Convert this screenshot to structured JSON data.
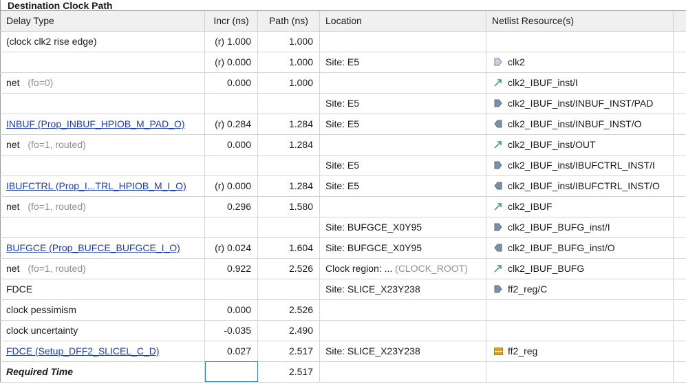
{
  "section_title": "Destination Clock Path",
  "columns": [
    "Delay Type",
    "Incr (ns)",
    "Path (ns)",
    "Location",
    "Netlist Resource(s)"
  ],
  "rows": [
    {
      "type": "(clock clk2 rise edge)",
      "type_dim": "",
      "link": false,
      "bold": false,
      "incr": "(r) 1.000",
      "path": "1.000",
      "location": "",
      "location_dim": "",
      "icon": "",
      "resource": ""
    },
    {
      "type": "",
      "type_dim": "",
      "link": false,
      "bold": false,
      "incr": "(r) 0.000",
      "path": "1.000",
      "location": "Site: E5",
      "location_dim": "",
      "icon": "port-icon",
      "resource": "clk2"
    },
    {
      "type": "net",
      "type_dim": " (fo=0)",
      "link": false,
      "bold": false,
      "incr": "0.000",
      "path": "1.000",
      "location": "",
      "location_dim": "",
      "icon": "net-icon",
      "resource": "clk2_IBUF_inst/I"
    },
    {
      "type": "",
      "type_dim": "",
      "link": false,
      "bold": false,
      "incr": "",
      "path": "",
      "location": "Site: E5",
      "location_dim": "",
      "icon": "input-pin-icon",
      "resource": "clk2_IBUF_inst/INBUF_INST/PAD"
    },
    {
      "type": "INBUF (Prop_INBUF_HPIOB_M_PAD_O)",
      "type_dim": "",
      "link": true,
      "bold": false,
      "incr": "(r) 0.284",
      "path": "1.284",
      "location": "Site: E5",
      "location_dim": "",
      "icon": "output-pin-icon",
      "resource": "clk2_IBUF_inst/INBUF_INST/O"
    },
    {
      "type": "net",
      "type_dim": " (fo=1, routed)",
      "link": false,
      "bold": false,
      "incr": "0.000",
      "path": "1.284",
      "location": "",
      "location_dim": "",
      "icon": "net-icon",
      "resource": "clk2_IBUF_inst/OUT"
    },
    {
      "type": "",
      "type_dim": "",
      "link": false,
      "bold": false,
      "incr": "",
      "path": "",
      "location": "Site: E5",
      "location_dim": "",
      "icon": "input-pin-icon",
      "resource": "clk2_IBUF_inst/IBUFCTRL_INST/I"
    },
    {
      "type": "IBUFCTRL (Prop_I...TRL_HPIOB_M_I_O)",
      "type_dim": "",
      "link": true,
      "bold": false,
      "incr": "(r) 0.000",
      "path": "1.284",
      "location": "Site: E5",
      "location_dim": "",
      "icon": "output-pin-icon",
      "resource": "clk2_IBUF_inst/IBUFCTRL_INST/O"
    },
    {
      "type": "net",
      "type_dim": " (fo=1, routed)",
      "link": false,
      "bold": false,
      "incr": "0.296",
      "path": "1.580",
      "location": "",
      "location_dim": "",
      "icon": "net-icon",
      "resource": "clk2_IBUF"
    },
    {
      "type": "",
      "type_dim": "",
      "link": false,
      "bold": false,
      "incr": "",
      "path": "",
      "location": "Site: BUFGCE_X0Y95",
      "location_dim": "",
      "icon": "input-pin-icon",
      "resource": "clk2_IBUF_BUFG_inst/I"
    },
    {
      "type": "BUFGCE (Prop_BUFCE_BUFGCE_I_O)",
      "type_dim": "",
      "link": true,
      "bold": false,
      "incr": "(r) 0.024",
      "path": "1.604",
      "location": "Site: BUFGCE_X0Y95",
      "location_dim": "",
      "icon": "output-pin-icon",
      "resource": "clk2_IBUF_BUFG_inst/O"
    },
    {
      "type": "net",
      "type_dim": " (fo=1, routed)",
      "link": false,
      "bold": false,
      "incr": "0.922",
      "path": "2.526",
      "location": "Clock region: ...",
      "location_dim": " (CLOCK_ROOT)",
      "icon": "net-icon",
      "resource": "clk2_IBUF_BUFG"
    },
    {
      "type": "FDCE",
      "type_dim": "",
      "link": false,
      "bold": false,
      "incr": "",
      "path": "",
      "location": "Site: SLICE_X23Y238",
      "location_dim": "",
      "icon": "input-pin-icon",
      "resource": "ff2_reg/C"
    },
    {
      "type": "clock pessimism",
      "type_dim": "",
      "link": false,
      "bold": false,
      "incr": "0.000",
      "path": "2.526",
      "location": "",
      "location_dim": "",
      "icon": "",
      "resource": ""
    },
    {
      "type": "clock uncertainty",
      "type_dim": "",
      "link": false,
      "bold": false,
      "incr": "-0.035",
      "path": "2.490",
      "location": "",
      "location_dim": "",
      "icon": "",
      "resource": ""
    },
    {
      "type": "FDCE (Setup_DFF2_SLICEL_C_D)",
      "type_dim": "",
      "link": true,
      "bold": false,
      "incr": "0.027",
      "path": "2.517",
      "location": "Site: SLICE_X23Y238",
      "location_dim": "",
      "icon": "cell-icon",
      "resource": "ff2_reg"
    },
    {
      "type": "Required Time",
      "type_dim": "",
      "link": false,
      "bold": true,
      "incr": "",
      "path": "2.517",
      "location": "",
      "location_dim": "",
      "icon": "",
      "resource": "",
      "incr_selected": true
    }
  ],
  "colors": {
    "link": "#1f3da6",
    "net_icon": "#2e9b5a",
    "pin_icon": "#7a8fa8",
    "cell_icon": "#e0a020",
    "header_bg": "#f0f0f0"
  }
}
